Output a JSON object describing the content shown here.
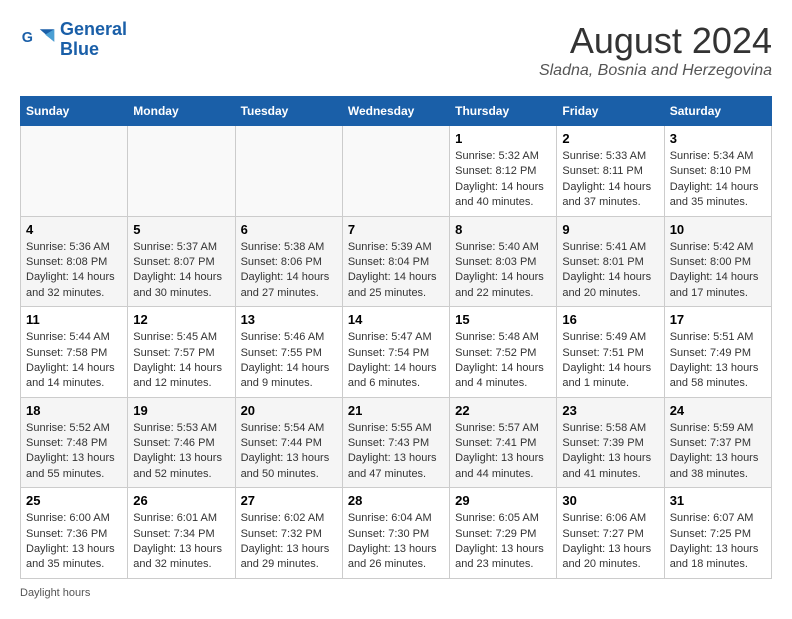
{
  "logo": {
    "line1": "General",
    "line2": "Blue"
  },
  "title": "August 2024",
  "location": "Sladna, Bosnia and Herzegovina",
  "days_of_week": [
    "Sunday",
    "Monday",
    "Tuesday",
    "Wednesday",
    "Thursday",
    "Friday",
    "Saturday"
  ],
  "weeks": [
    [
      {
        "day": "",
        "info": ""
      },
      {
        "day": "",
        "info": ""
      },
      {
        "day": "",
        "info": ""
      },
      {
        "day": "",
        "info": ""
      },
      {
        "day": "1",
        "info": "Sunrise: 5:32 AM\nSunset: 8:12 PM\nDaylight: 14 hours and 40 minutes."
      },
      {
        "day": "2",
        "info": "Sunrise: 5:33 AM\nSunset: 8:11 PM\nDaylight: 14 hours and 37 minutes."
      },
      {
        "day": "3",
        "info": "Sunrise: 5:34 AM\nSunset: 8:10 PM\nDaylight: 14 hours and 35 minutes."
      }
    ],
    [
      {
        "day": "4",
        "info": "Sunrise: 5:36 AM\nSunset: 8:08 PM\nDaylight: 14 hours and 32 minutes."
      },
      {
        "day": "5",
        "info": "Sunrise: 5:37 AM\nSunset: 8:07 PM\nDaylight: 14 hours and 30 minutes."
      },
      {
        "day": "6",
        "info": "Sunrise: 5:38 AM\nSunset: 8:06 PM\nDaylight: 14 hours and 27 minutes."
      },
      {
        "day": "7",
        "info": "Sunrise: 5:39 AM\nSunset: 8:04 PM\nDaylight: 14 hours and 25 minutes."
      },
      {
        "day": "8",
        "info": "Sunrise: 5:40 AM\nSunset: 8:03 PM\nDaylight: 14 hours and 22 minutes."
      },
      {
        "day": "9",
        "info": "Sunrise: 5:41 AM\nSunset: 8:01 PM\nDaylight: 14 hours and 20 minutes."
      },
      {
        "day": "10",
        "info": "Sunrise: 5:42 AM\nSunset: 8:00 PM\nDaylight: 14 hours and 17 minutes."
      }
    ],
    [
      {
        "day": "11",
        "info": "Sunrise: 5:44 AM\nSunset: 7:58 PM\nDaylight: 14 hours and 14 minutes."
      },
      {
        "day": "12",
        "info": "Sunrise: 5:45 AM\nSunset: 7:57 PM\nDaylight: 14 hours and 12 minutes."
      },
      {
        "day": "13",
        "info": "Sunrise: 5:46 AM\nSunset: 7:55 PM\nDaylight: 14 hours and 9 minutes."
      },
      {
        "day": "14",
        "info": "Sunrise: 5:47 AM\nSunset: 7:54 PM\nDaylight: 14 hours and 6 minutes."
      },
      {
        "day": "15",
        "info": "Sunrise: 5:48 AM\nSunset: 7:52 PM\nDaylight: 14 hours and 4 minutes."
      },
      {
        "day": "16",
        "info": "Sunrise: 5:49 AM\nSunset: 7:51 PM\nDaylight: 14 hours and 1 minute."
      },
      {
        "day": "17",
        "info": "Sunrise: 5:51 AM\nSunset: 7:49 PM\nDaylight: 13 hours and 58 minutes."
      }
    ],
    [
      {
        "day": "18",
        "info": "Sunrise: 5:52 AM\nSunset: 7:48 PM\nDaylight: 13 hours and 55 minutes."
      },
      {
        "day": "19",
        "info": "Sunrise: 5:53 AM\nSunset: 7:46 PM\nDaylight: 13 hours and 52 minutes."
      },
      {
        "day": "20",
        "info": "Sunrise: 5:54 AM\nSunset: 7:44 PM\nDaylight: 13 hours and 50 minutes."
      },
      {
        "day": "21",
        "info": "Sunrise: 5:55 AM\nSunset: 7:43 PM\nDaylight: 13 hours and 47 minutes."
      },
      {
        "day": "22",
        "info": "Sunrise: 5:57 AM\nSunset: 7:41 PM\nDaylight: 13 hours and 44 minutes."
      },
      {
        "day": "23",
        "info": "Sunrise: 5:58 AM\nSunset: 7:39 PM\nDaylight: 13 hours and 41 minutes."
      },
      {
        "day": "24",
        "info": "Sunrise: 5:59 AM\nSunset: 7:37 PM\nDaylight: 13 hours and 38 minutes."
      }
    ],
    [
      {
        "day": "25",
        "info": "Sunrise: 6:00 AM\nSunset: 7:36 PM\nDaylight: 13 hours and 35 minutes."
      },
      {
        "day": "26",
        "info": "Sunrise: 6:01 AM\nSunset: 7:34 PM\nDaylight: 13 hours and 32 minutes."
      },
      {
        "day": "27",
        "info": "Sunrise: 6:02 AM\nSunset: 7:32 PM\nDaylight: 13 hours and 29 minutes."
      },
      {
        "day": "28",
        "info": "Sunrise: 6:04 AM\nSunset: 7:30 PM\nDaylight: 13 hours and 26 minutes."
      },
      {
        "day": "29",
        "info": "Sunrise: 6:05 AM\nSunset: 7:29 PM\nDaylight: 13 hours and 23 minutes."
      },
      {
        "day": "30",
        "info": "Sunrise: 6:06 AM\nSunset: 7:27 PM\nDaylight: 13 hours and 20 minutes."
      },
      {
        "day": "31",
        "info": "Sunrise: 6:07 AM\nSunset: 7:25 PM\nDaylight: 13 hours and 18 minutes."
      }
    ]
  ],
  "footer": "Daylight hours"
}
